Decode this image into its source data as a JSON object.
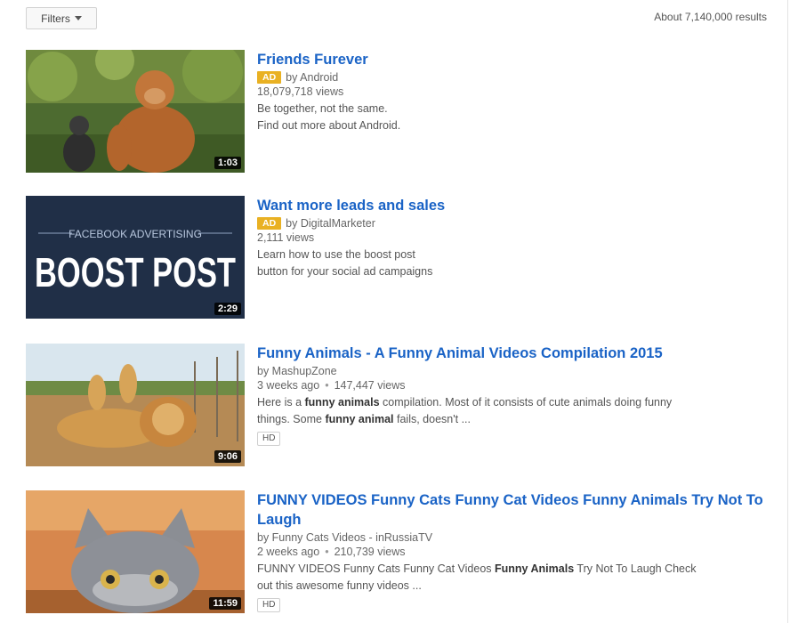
{
  "toolbar": {
    "filters_label": "Filters",
    "results_count": "About 7,140,000 results"
  },
  "results": [
    {
      "title": "Friends Furever",
      "ad_label": "AD",
      "channel": "by Android",
      "views": "18,079,718 views",
      "desc_line1": "Be together, not the same.",
      "desc_line2": "Find out more about Android.",
      "duration": "1:03"
    },
    {
      "title": "Want more leads and sales",
      "ad_label": "AD",
      "channel": "by DigitalMarketer",
      "views": "2,111 views",
      "desc_line1": "Learn how to use the boost post",
      "desc_line2": "button for your social ad campaigns",
      "duration": "2:29",
      "thumb_small": "FACEBOOK ADVERTISING",
      "thumb_big": "BOOST POST"
    },
    {
      "title": "Funny Animals - A Funny Animal Videos Compilation 2015",
      "channel": "by MashupZone",
      "age": "3 weeks ago",
      "views": "147,447 views",
      "desc_line1": {
        "t1": "Here is a ",
        "b1": "funny animals",
        "t2": " compilation. Most of it consists of cute animals doing funny"
      },
      "desc_line2": {
        "t1": "things. Some ",
        "b1": "funny animal",
        "t2": " fails, doesn't ..."
      },
      "badge": "HD",
      "duration": "9:06"
    },
    {
      "title_line1": "FUNNY VIDEOS Funny Cats Funny Cat Videos Funny Animals Try Not To",
      "title_line2": "Laugh",
      "channel": "by Funny Cats Videos - inRussiaTV",
      "age": "2 weeks ago",
      "views": "210,739 views",
      "desc_line1": {
        "t1": "FUNNY VIDEOS Funny Cats Funny Cat Videos ",
        "b1": "Funny Animals",
        "t2": " Try Not To Laugh Check"
      },
      "desc_line2": "out this awesome funny videos ...",
      "badge": "HD",
      "duration": "11:59"
    }
  ],
  "colors": {
    "title_link": "#1a63c6",
    "ad_badge": "#e9b123"
  }
}
